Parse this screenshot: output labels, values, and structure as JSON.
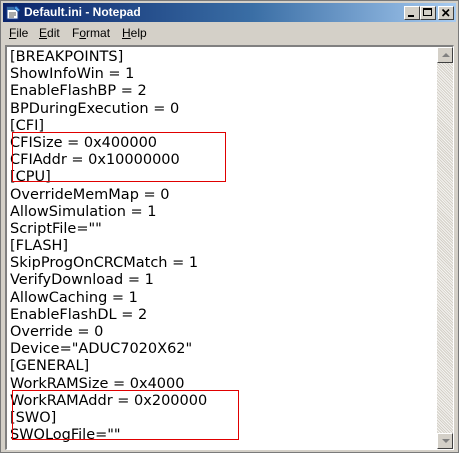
{
  "window": {
    "title": "Default.ini - Notepad"
  },
  "icons": {
    "app": "notepad-icon",
    "minimize": "minimize-icon",
    "maximize": "maximize-icon",
    "close": "close-icon"
  },
  "menu": [
    {
      "accel": "F",
      "rest": "ile"
    },
    {
      "accel": "E",
      "rest": "dit"
    },
    {
      "accel": "o",
      "pre": "F",
      "rest": "rmat"
    },
    {
      "accel": "H",
      "rest": "elp"
    }
  ],
  "editor": {
    "lines": [
      "[BREAKPOINTS]",
      "ShowInfoWin = 1",
      "EnableFlashBP = 2",
      "BPDuringExecution = 0",
      "[CFI]",
      "CFISize = 0x400000",
      "CFIAddr = 0x10000000",
      "[CPU]",
      "OverrideMemMap = 0",
      "AllowSimulation = 1",
      "ScriptFile=\"\"",
      "[FLASH]",
      "SkipProgOnCRCMatch = 1",
      "VerifyDownload = 1",
      "AllowCaching = 1",
      "EnableFlashDL = 2",
      "Override = 0",
      "Device=\"ADUC7020X62\"",
      "[GENERAL]",
      "WorkRAMSize = 0x4000",
      "WorkRAMAddr = 0x200000",
      "[SWO]",
      "SWOLogFile=\"\""
    ]
  },
  "highlight_color": "#e00000"
}
